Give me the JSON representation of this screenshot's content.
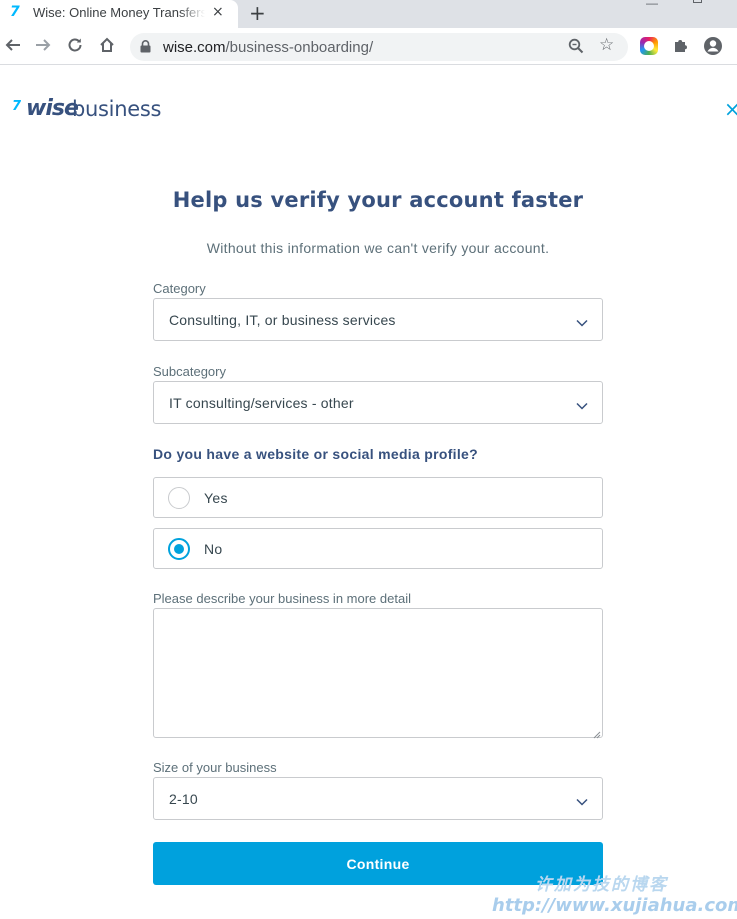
{
  "browser": {
    "tab_favicon": "7",
    "tab_title": "Wise: Online Money Transfers",
    "tab_close": "×",
    "new_tab": "+",
    "url_host": "wise.com",
    "url_path": "/business-onboarding/",
    "icons": [
      "back-arrow-icon",
      "forward-arrow-icon",
      "reload-icon",
      "home-icon",
      "lock-icon",
      "zoom-icon",
      "bookmark-star-icon",
      "color-extension-icon",
      "extensions-puzzle-icon",
      "profile-icon"
    ]
  },
  "header": {
    "logo_mark": "7",
    "logo_wise": "wise",
    "logo_business": "business",
    "close": "×"
  },
  "form": {
    "heading": "Help us verify your account faster",
    "subheading": "Without this information we can't verify your account.",
    "category": {
      "label": "Category",
      "value": "Consulting, IT, or business services"
    },
    "subcategory": {
      "label": "Subcategory",
      "value": "IT consulting/services - other"
    },
    "website_question": "Do you have a website or social media profile?",
    "website_options": [
      {
        "label": "Yes",
        "selected": false
      },
      {
        "label": "No",
        "selected": true
      }
    ],
    "description": {
      "label": "Please describe your business in more detail",
      "value": ""
    },
    "size": {
      "label": "Size of your business",
      "value": "2-10"
    },
    "continue_label": "Continue"
  },
  "colors": {
    "accent": "#00a1dd",
    "heading": "#37517e",
    "border": "#c9cbce"
  },
  "watermark": {
    "text_cn": "许加为技的博客",
    "url": "http://www.xujiahua.com"
  }
}
